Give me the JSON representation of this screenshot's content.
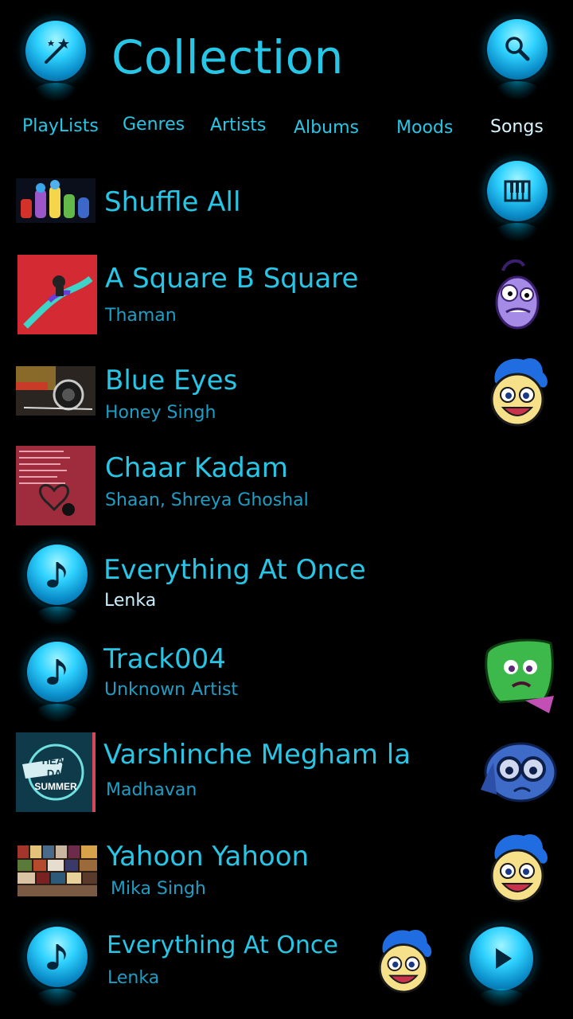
{
  "header": {
    "title": "Collection",
    "left_icon": "magic-wand-icon",
    "right_icon": "search-icon"
  },
  "tabs": [
    "PlayLists",
    "Genres",
    "Artists",
    "Albums",
    "Moods",
    "Songs"
  ],
  "active_tab": "Songs",
  "shuffle": {
    "label": "Shuffle All",
    "icon": "piano-icon"
  },
  "songs": [
    {
      "title": "A Square B Square",
      "artist": "Thaman",
      "art": "album-art",
      "mood": "fear"
    },
    {
      "title": "Blue Eyes",
      "artist": "Honey Singh",
      "art": "album-art",
      "mood": "joy"
    },
    {
      "title": "Chaar Kadam",
      "artist": "Shaan, Shreya Ghoshal",
      "art": "album-art",
      "mood": ""
    },
    {
      "title": "Everything At Once",
      "artist": "Lenka",
      "art": "music-note-icon",
      "mood": ""
    },
    {
      "title": "Track004",
      "artist": "Unknown Artist",
      "art": "music-note-icon",
      "mood": "disgust"
    },
    {
      "title": "Varshinche Megham la",
      "artist": "Madhavan",
      "art": "album-art",
      "mood": "sadness"
    },
    {
      "title": "Yahoon Yahoon",
      "artist": "Mika Singh",
      "art": "album-art",
      "mood": "joy"
    }
  ],
  "heat_day_summer_lines": [
    "HEAT",
    "DAY",
    "SUMMER"
  ],
  "now_playing": {
    "title": "Everything At Once",
    "artist": "Lenka",
    "mood": "joy",
    "play_icon": "play-icon"
  },
  "colors": {
    "accent": "#27c6e6",
    "artist": "#1d9ec4",
    "background": "#000000"
  }
}
